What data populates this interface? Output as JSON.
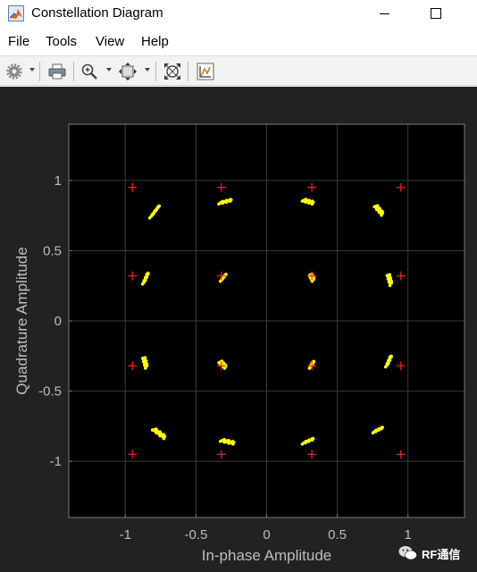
{
  "window": {
    "title": "Constellation Diagram"
  },
  "menu": {
    "file": "File",
    "tools": "Tools",
    "view": "View",
    "help": "Help"
  },
  "watermark": {
    "text": "RF通信"
  },
  "chart_data": {
    "type": "scatter",
    "title": "",
    "xlabel": "In-phase Amplitude",
    "ylabel": "Quadrature Amplitude",
    "xlim": [
      -1.4,
      1.4
    ],
    "ylim": [
      -1.4,
      1.4
    ],
    "xticks": [
      -1,
      -0.5,
      0,
      0.5,
      1
    ],
    "xtick_labels": [
      "-1",
      "-0.5",
      "0",
      "0.5",
      "1"
    ],
    "yticks": [
      -1,
      -0.5,
      0,
      0.5,
      1
    ],
    "ytick_labels": [
      "-1",
      "-0.5",
      "0",
      "0.5",
      "1"
    ],
    "grid": true,
    "background": "#000000",
    "series": [
      {
        "marker": "plus",
        "color": "#ff2020",
        "points": [
          [
            -0.95,
            0.95
          ],
          [
            -0.32,
            0.95
          ],
          [
            0.32,
            0.95
          ],
          [
            0.95,
            0.95
          ],
          [
            -0.95,
            0.32
          ],
          [
            -0.32,
            0.32
          ],
          [
            0.32,
            0.32
          ],
          [
            0.95,
            0.32
          ],
          [
            -0.95,
            -0.32
          ],
          [
            -0.32,
            -0.32
          ],
          [
            0.32,
            -0.32
          ],
          [
            0.95,
            -0.32
          ],
          [
            -0.95,
            -0.95
          ],
          [
            -0.32,
            -0.95
          ],
          [
            0.32,
            -0.95
          ],
          [
            0.95,
            -0.95
          ]
        ]
      },
      {
        "marker": "dot",
        "color": "#ffff00",
        "clusters": [
          {
            "from": [
              -0.82,
              0.74
            ],
            "to": [
              -0.76,
              0.82
            ]
          },
          {
            "from": [
              -0.33,
              0.84
            ],
            "to": [
              -0.25,
              0.86
            ]
          },
          {
            "from": [
              0.26,
              0.86
            ],
            "to": [
              0.33,
              0.84
            ]
          },
          {
            "from": [
              0.77,
              0.82
            ],
            "to": [
              0.82,
              0.76
            ]
          },
          {
            "from": [
              -0.87,
              0.27
            ],
            "to": [
              -0.84,
              0.34
            ]
          },
          {
            "from": [
              -0.32,
              0.29
            ],
            "to": [
              -0.29,
              0.33
            ]
          },
          {
            "from": [
              0.31,
              0.33
            ],
            "to": [
              0.33,
              0.29
            ]
          },
          {
            "from": [
              0.86,
              0.33
            ],
            "to": [
              0.88,
              0.26
            ]
          },
          {
            "from": [
              -0.87,
              -0.26
            ],
            "to": [
              -0.85,
              -0.33
            ]
          },
          {
            "from": [
              -0.33,
              -0.29
            ],
            "to": [
              -0.29,
              -0.33
            ]
          },
          {
            "from": [
              0.31,
              -0.33
            ],
            "to": [
              0.33,
              -0.29
            ]
          },
          {
            "from": [
              0.85,
              -0.32
            ],
            "to": [
              0.88,
              -0.25
            ]
          },
          {
            "from": [
              -0.8,
              -0.77
            ],
            "to": [
              -0.72,
              -0.83
            ]
          },
          {
            "from": [
              -0.32,
              -0.85
            ],
            "to": [
              -0.23,
              -0.87
            ]
          },
          {
            "from": [
              0.26,
              -0.87
            ],
            "to": [
              0.33,
              -0.84
            ]
          },
          {
            "from": [
              0.76,
              -0.79
            ],
            "to": [
              0.82,
              -0.76
            ]
          }
        ]
      }
    ]
  }
}
